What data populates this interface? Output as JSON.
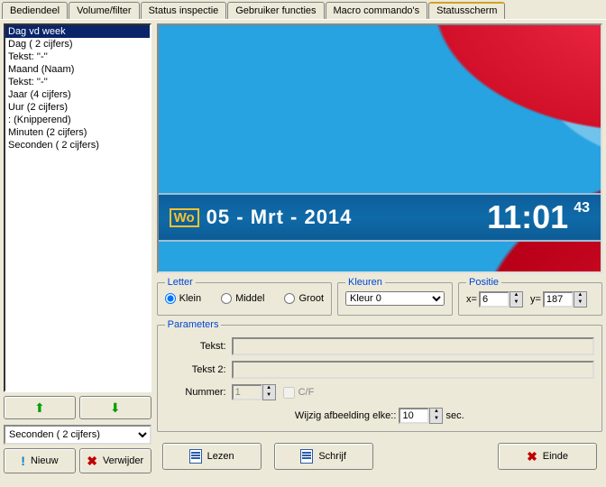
{
  "tabs": [
    "Bediendeel",
    "Volume/filter",
    "Status inspectie",
    "Gebruiker functies",
    "Macro commando's",
    "Statusscherm"
  ],
  "active_tab": 5,
  "list_items": [
    "Dag vd week",
    "Dag ( 2 cijfers)",
    "Tekst: ''-''",
    "Maand (Naam)",
    "Tekst: ''-''",
    "Jaar (4 cijfers)",
    "Uur (2 cijfers)",
    " :  (Knipperend)",
    "Minuten (2 cijfers)",
    "Seconden ( 2 cijfers)"
  ],
  "list_selected": 0,
  "combo_value": "Seconden ( 2 cijfers)",
  "btn_nieuw": "Nieuw",
  "btn_verwijder": "Verwijder",
  "preview": {
    "wo": "Wo",
    "date": "05 - Mrt - 2014",
    "time": "11:01",
    "seconds": "43"
  },
  "groups": {
    "letter": "Letter",
    "kleuren": "Kleuren",
    "positie": "Positie",
    "parameters": "Parameters"
  },
  "radios": {
    "klein": "Klein",
    "middel": "Middel",
    "groot": "Groot"
  },
  "kleur_value": "Kleur 0",
  "pos": {
    "x_label": "x=",
    "x": "6",
    "y_label": "y=",
    "y": "187"
  },
  "params": {
    "tekst_lbl": "Tekst:",
    "tekst": "",
    "tekst2_lbl": "Tekst 2:",
    "tekst2": "",
    "nummer_lbl": "Nummer:",
    "nummer": "1",
    "cf": "C/F"
  },
  "wijzig": {
    "pre": "Wijzig afbeelding elke::",
    "val": "10",
    "post": "sec."
  },
  "actions": {
    "lezen": "Lezen",
    "schrijf": "Schrijf",
    "einde": "Einde"
  }
}
